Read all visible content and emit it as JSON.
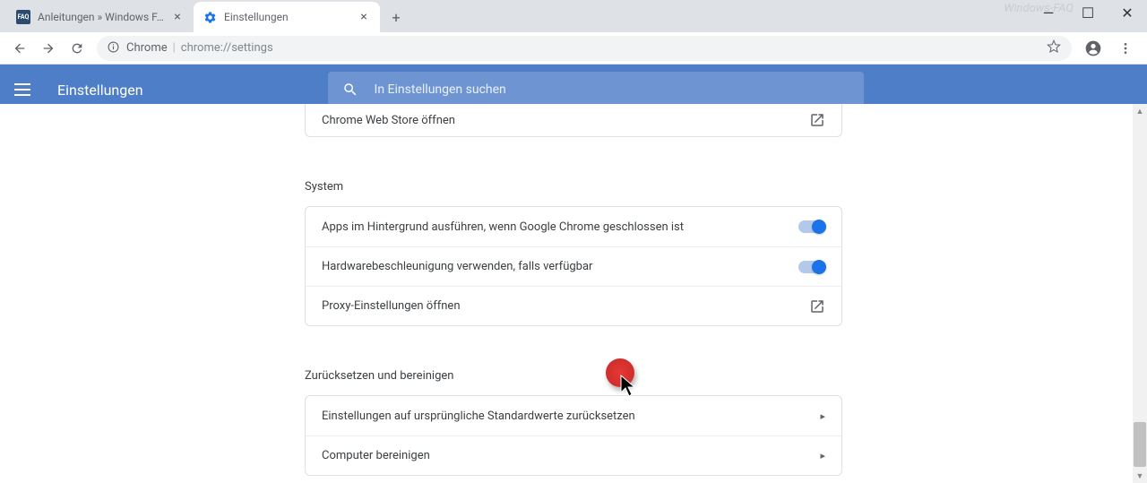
{
  "window": {
    "watermark": "Windows-FAQ",
    "minimize": "—",
    "maximize": "☐",
    "close": "✕"
  },
  "tabs": {
    "tab1": {
      "title": "Anleitungen » Windows FAQ"
    },
    "tab2": {
      "title": "Einstellungen"
    }
  },
  "toolbar": {
    "chrome_label": "Chrome",
    "url": "chrome://settings"
  },
  "header": {
    "title": "Einstellungen"
  },
  "search": {
    "placeholder": "In Einstellungen suchen"
  },
  "rows": {
    "webstore": "Chrome Web Store öffnen",
    "section_system": "System",
    "bg_apps": "Apps im Hintergrund ausführen, wenn Google Chrome geschlossen ist",
    "hw_accel": "Hardwarebeschleunigung verwenden, falls verfügbar",
    "proxy": "Proxy-Einstellungen öffnen",
    "section_reset": "Zurücksetzen und bereinigen",
    "reset_defaults": "Einstellungen auf ursprüngliche Standardwerte zurücksetzen",
    "cleanup": "Computer bereinigen"
  }
}
